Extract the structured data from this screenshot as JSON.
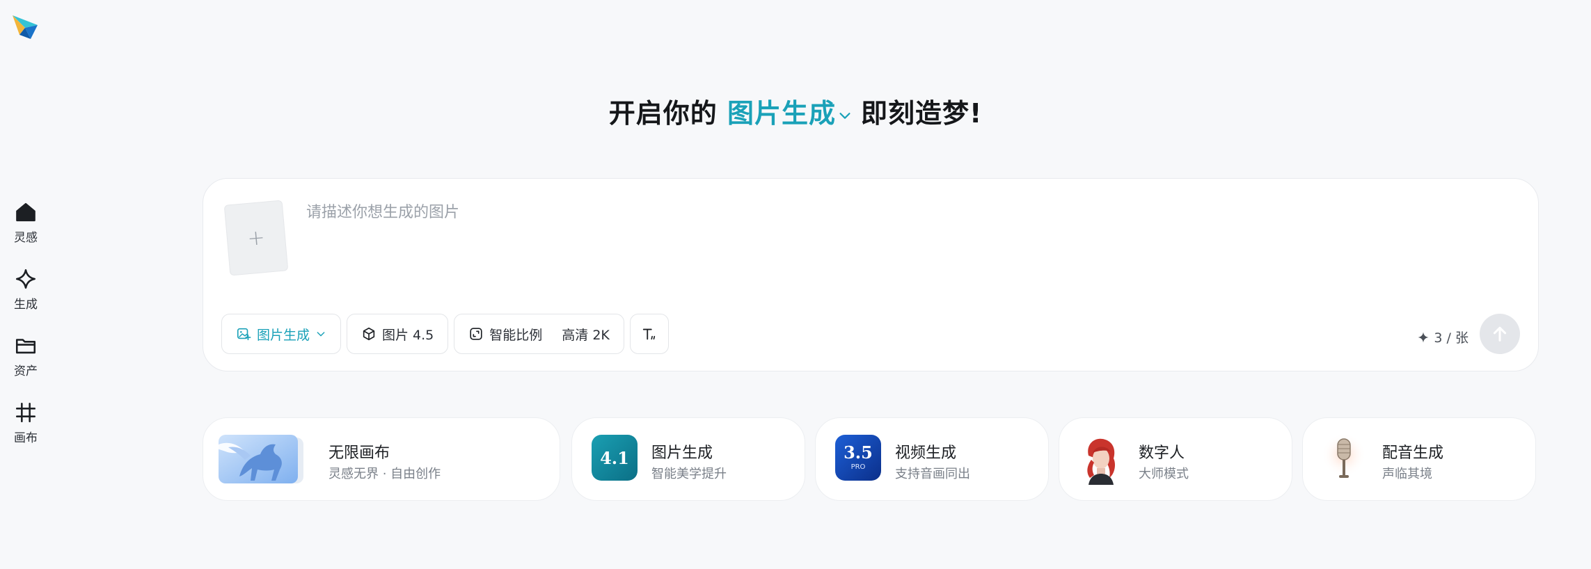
{
  "sidebar": {
    "items": [
      {
        "label": "灵感",
        "icon": "home-icon"
      },
      {
        "label": "生成",
        "icon": "sparkle-diamond-icon"
      },
      {
        "label": "资产",
        "icon": "folder-icon"
      },
      {
        "label": "画布",
        "icon": "grid-hash-icon"
      }
    ]
  },
  "headline": {
    "prefix": "开启你的",
    "mode": "图片生成",
    "suffix": "即刻造梦!"
  },
  "composer": {
    "upload_label": "+",
    "prompt_placeholder": "请描述你想生成的图片",
    "prompt_value": "",
    "mode_chip": "图片生成",
    "model_chip": "图片 4.5",
    "ratio_label": "智能比例",
    "quality_label": "高清 2K",
    "credits": "3 / 张"
  },
  "cards": [
    {
      "title": "无限画布",
      "subtitle": "灵感无界 · 自由创作",
      "thumb_text": ""
    },
    {
      "title": "图片生成",
      "subtitle": "智能美学提升",
      "thumb_text": "4.1"
    },
    {
      "title": "视频生成",
      "subtitle": "支持音画同出",
      "thumb_text": "3.5",
      "thumb_badge": "PRO"
    },
    {
      "title": "数字人",
      "subtitle": "大师模式",
      "thumb_text": ""
    },
    {
      "title": "配音生成",
      "subtitle": "声临其境",
      "thumb_text": ""
    }
  ],
  "colors": {
    "accent": "#1aa1b8",
    "background": "#f7f8fa",
    "send_disabled": "#e4e6ea"
  }
}
